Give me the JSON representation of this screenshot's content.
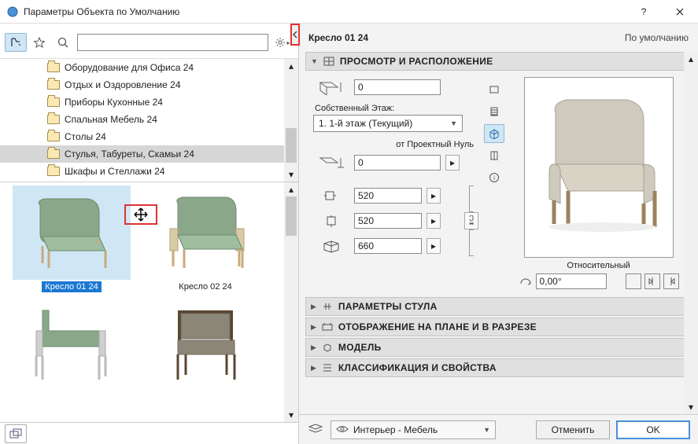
{
  "window": {
    "title": "Параметры Объекта по Умолчанию"
  },
  "left": {
    "search_placeholder": "",
    "tree": {
      "items": [
        {
          "label": "Оборудование для Офиса 24"
        },
        {
          "label": "Отдых и Оздоровление 24"
        },
        {
          "label": "Приборы Кухонные 24"
        },
        {
          "label": "Спальная Мебель 24"
        },
        {
          "label": "Столы 24"
        },
        {
          "label": "Стулья, Табуреты, Скамьи 24"
        },
        {
          "label": "Шкафы и Стеллажи 24"
        }
      ]
    },
    "thumbs": [
      {
        "label": "Кресло 01 24"
      },
      {
        "label": "Кресло 02 24"
      },
      {
        "label": ""
      },
      {
        "label": ""
      }
    ]
  },
  "right": {
    "object_name": "Кресло 01 24",
    "default_label": "По умолчанию",
    "panels": {
      "preview": {
        "title": "ПРОСМОТР И РАСПОЛОЖЕНИЕ"
      },
      "params": {
        "title": "ПАРАМЕТРЫ СТУЛА"
      },
      "plan": {
        "title": "ОТОБРАЖЕНИЕ НА ПЛАНЕ И В РАЗРЕЗЕ"
      },
      "model": {
        "title": "МОДЕЛЬ"
      },
      "class": {
        "title": "КЛАССИФИКАЦИЯ И СВОЙСТВА"
      }
    },
    "fields": {
      "anchor_z": "0",
      "own_story_label": "Собственный Этаж:",
      "story_value": "1. 1-й этаж (Текущий)",
      "ref_label": "от Проектный Нуль",
      "ref_z": "0",
      "dim_x": "520",
      "dim_y": "520",
      "dim_z": "660",
      "relative_label": "Относительный",
      "angle": "0,00°"
    },
    "layer": {
      "value": "Интерьер - Мебель"
    },
    "buttons": {
      "cancel": "Отменить",
      "ok": "OK"
    }
  }
}
